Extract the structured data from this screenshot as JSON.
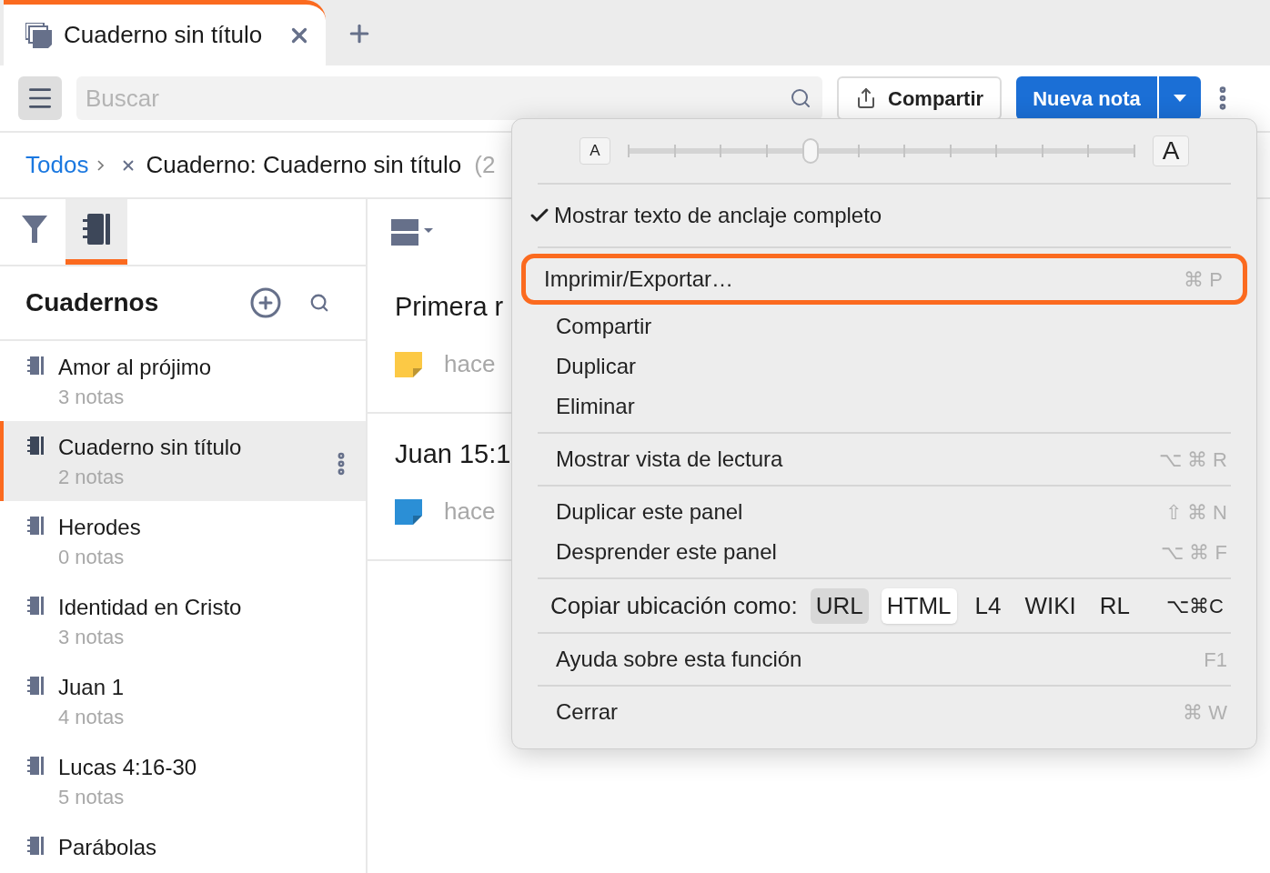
{
  "tab": {
    "title": "Cuaderno sin título",
    "selected": true
  },
  "toolbar": {
    "search": {
      "placeholder": "Buscar"
    },
    "share_button": "Compartir",
    "new_note_button": "Nueva nota"
  },
  "breadcrumb": {
    "root": "Todos",
    "filter": "Cuaderno: Cuaderno sin título",
    "count": "(2"
  },
  "sidebar": {
    "tabs": [
      {
        "kind": "filter",
        "selected": false
      },
      {
        "kind": "notebooks",
        "selected": true
      }
    ],
    "title": "Cuadernos",
    "items": [
      {
        "name": "Amor al prójimo",
        "count": "3 notas",
        "selected": false
      },
      {
        "name": "Cuaderno sin título",
        "count": "2 notas",
        "selected": true
      },
      {
        "name": "Herodes",
        "count": "0 notas",
        "selected": false
      },
      {
        "name": "Identidad en Cristo",
        "count": "3 notas",
        "selected": false
      },
      {
        "name": "Juan 1",
        "count": "4 notas",
        "selected": false
      },
      {
        "name": "Lucas 4:16-30",
        "count": "5 notas",
        "selected": false
      },
      {
        "name": "Parábolas"
      }
    ]
  },
  "notes": [
    {
      "title": "Primera r",
      "time": "hace",
      "color": "#fcc945"
    },
    {
      "title": "Juan 15:1",
      "time": "hace",
      "color": "#2b8fd6"
    }
  ],
  "menu": {
    "font_size": {
      "small": "A",
      "large": "A",
      "level": 0.36
    },
    "sections": [
      [
        {
          "kind": "check",
          "label": "Mostrar texto de anclaje completo",
          "checked": true
        }
      ],
      [
        {
          "kind": "command",
          "label": "Imprimir/Exportar…",
          "shortcut": "⌘ P",
          "highlighted": true
        },
        {
          "kind": "command",
          "label": "Compartir",
          "highlighted": false
        },
        {
          "kind": "command",
          "label": "Duplicar",
          "highlighted": false
        },
        {
          "kind": "command",
          "label": "Eliminar",
          "highlighted": false
        }
      ],
      [
        {
          "kind": "command",
          "label": "Mostrar vista de lectura",
          "shortcut": "⌥ ⌘ R",
          "highlighted": false
        }
      ],
      [
        {
          "kind": "command",
          "label": "Duplicar este panel",
          "shortcut": "⇧ ⌘ N",
          "highlighted": false
        },
        {
          "kind": "command",
          "label": "Desprender este panel",
          "shortcut": "⌥ ⌘ F",
          "highlighted": false
        }
      ],
      [
        {
          "kind": "copy",
          "label": "Copiar ubicación como:",
          "shortcut": "⌥⌘C",
          "formats": [
            {
              "label": "URL",
              "selected": true,
              "hovered": false
            },
            {
              "label": "HTML",
              "selected": false,
              "hovered": true
            },
            {
              "label": "L4",
              "selected": false,
              "hovered": false
            },
            {
              "label": "WIKI",
              "selected": false,
              "hovered": false
            },
            {
              "label": "RL",
              "selected": false,
              "hovered": false
            }
          ]
        }
      ],
      [
        {
          "kind": "command",
          "label": "Ayuda sobre esta función",
          "shortcut": "F1",
          "highlighted": false
        }
      ],
      [
        {
          "kind": "command",
          "label": "Cerrar",
          "shortcut": "⌘ W",
          "highlighted": false
        }
      ]
    ]
  }
}
